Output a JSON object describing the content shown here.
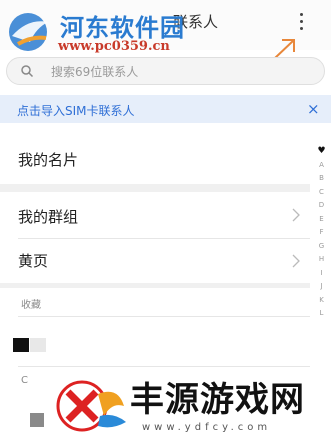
{
  "header": {
    "tab_label": "联系人",
    "menu_icon": "more-vertical-icon"
  },
  "watermark_top": {
    "title": "河东软件园",
    "url": "www.pc0359.cn"
  },
  "search": {
    "placeholder": "搜索69位联系人",
    "icon": "search-icon"
  },
  "sim_banner": {
    "text": "点击导入SIM卡联系人",
    "close": "×"
  },
  "rows": {
    "my_card": "我的名片",
    "my_groups": "我的群组",
    "yellow_pages": "黄页"
  },
  "sections": {
    "favorites": "收藏",
    "c": "C"
  },
  "index_bar": [
    "♥",
    "A",
    "B",
    "C",
    "D",
    "E",
    "F",
    "G",
    "H",
    "I",
    "J",
    "K",
    "L"
  ],
  "watermark_bottom": {
    "title": "丰源游戏网",
    "url": "www.ydfcy.com"
  },
  "colors": {
    "accent": "#2f6fd6",
    "banner_bg": "#e6eefa",
    "arrow": "#e8873a"
  }
}
